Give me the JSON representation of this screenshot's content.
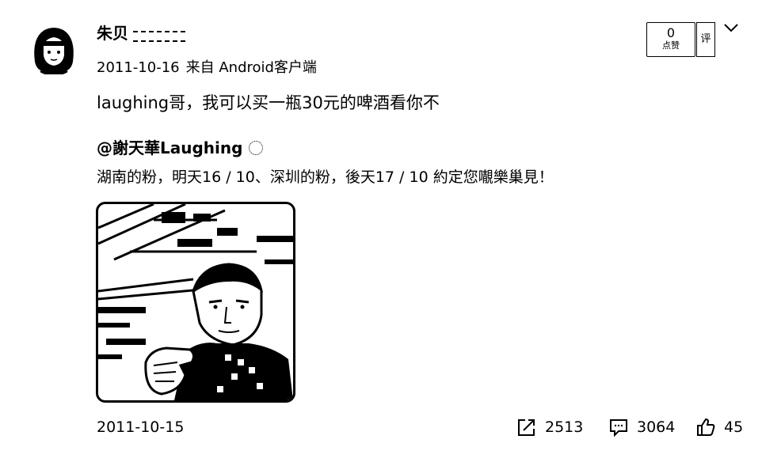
{
  "post": {
    "author_name": "朱贝",
    "source_prefix": "来自",
    "date": "2011-10-16",
    "source": "Android客户端",
    "text": "laughing哥，我可以买一瓶30元的啤酒看你不"
  },
  "like_box": {
    "count": "0",
    "label": "点赞"
  },
  "side_mark": {
    "text": "评"
  },
  "quoted": {
    "author": "@謝天華Laughing",
    "text": "湖南的粉，明天16 / 10、深圳的粉，後天17 / 10 約定您𡃁樂巢見！",
    "date": "2011-10-15"
  },
  "actions": {
    "share_count": "2513",
    "comment_count": "3064",
    "like_count": "45"
  },
  "icons": {
    "share": "share-icon",
    "comment": "comment-icon",
    "like": "thumbs-up-icon",
    "menu": "chevron-down-icon"
  }
}
